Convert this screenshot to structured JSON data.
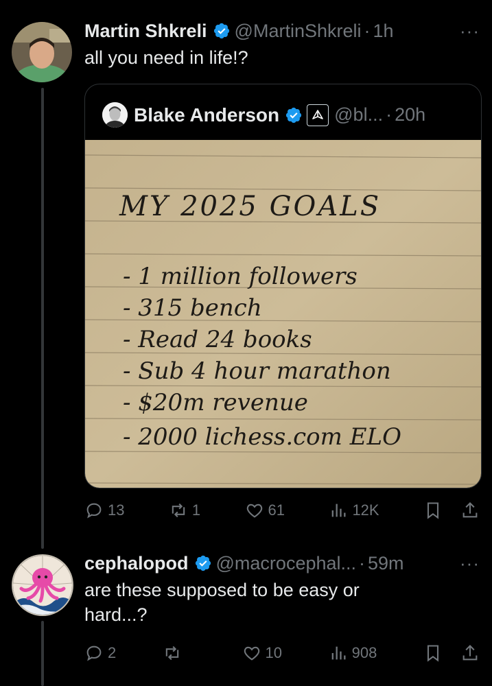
{
  "tweet1": {
    "name": "Martin Shkreli",
    "handle": "@MartinShkreli",
    "dot": "·",
    "time": "1h",
    "more": "···",
    "text": "all you need in life!?"
  },
  "quote": {
    "name": "Blake Anderson",
    "handle": "@bl...",
    "dot": "·",
    "time": "20h",
    "note_title": "MY 2025 GOALS",
    "note_items": [
      "- 1 million followers",
      "- 315 bench",
      "- Read 24 books",
      "- Sub 4 hour marathon",
      "- $20m revenue",
      "- 2000 lichess.com ELO"
    ]
  },
  "actions1": {
    "replies": "13",
    "reposts": "1",
    "likes": "61",
    "views": "12K"
  },
  "tweet2": {
    "name": "cephalopod",
    "handle": "@macrocephal...",
    "dot": "·",
    "time": "59m",
    "more": "···",
    "text": "are these supposed to be easy or hard...?"
  },
  "actions2": {
    "replies": "2",
    "reposts": "",
    "likes": "10",
    "views": "908"
  },
  "colors": {
    "background": "#000000",
    "text": "#e7e9ea",
    "muted": "#71767b",
    "verified": "#1d9bf0",
    "border": "#2f3336",
    "paper": "#c9b894"
  }
}
